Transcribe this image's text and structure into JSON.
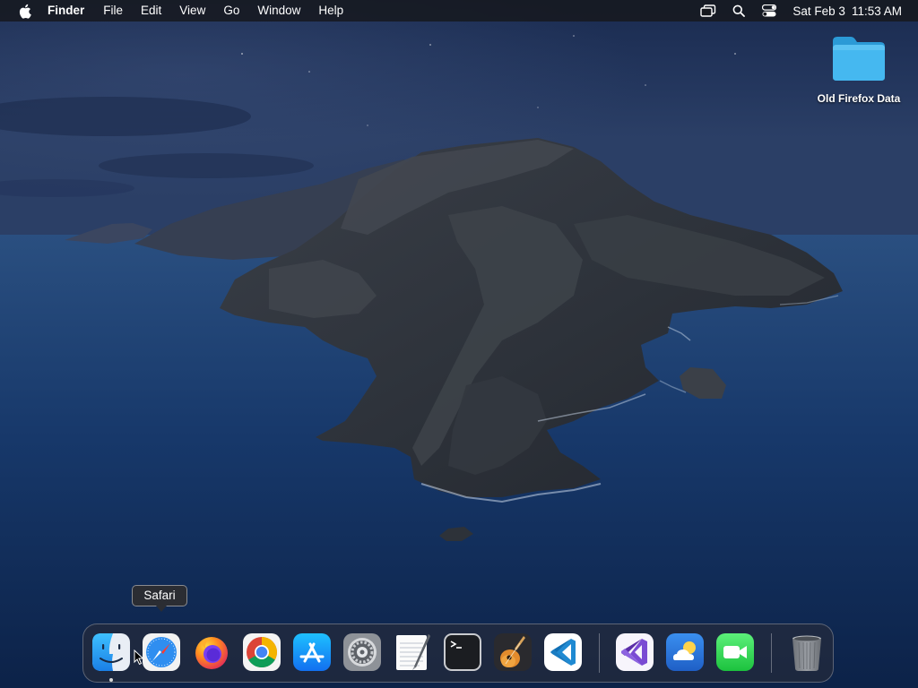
{
  "menubar": {
    "apple_icon": "apple-logo-icon",
    "app_name": "Finder",
    "menus": [
      "File",
      "Edit",
      "View",
      "Go",
      "Window",
      "Help"
    ],
    "status_icons": [
      "screen-mirroring-icon",
      "spotlight-search-icon",
      "control-center-icon"
    ],
    "clock": {
      "date": "Sat Feb 3",
      "time": "11:53 AM"
    }
  },
  "desktop": {
    "items": [
      {
        "label": "Old Firefox Data",
        "icon": "folder-icon",
        "color": "#3aaeea"
      }
    ]
  },
  "tooltip": {
    "text": "Safari"
  },
  "dock": {
    "apps": [
      {
        "name": "Finder",
        "icon": "finder-icon",
        "running": true
      },
      {
        "name": "Safari",
        "icon": "safari-icon",
        "running": false
      },
      {
        "name": "Firefox",
        "icon": "firefox-icon",
        "running": false
      },
      {
        "name": "Google Chrome",
        "icon": "chrome-icon",
        "running": false
      },
      {
        "name": "App Store",
        "icon": "app-store-icon",
        "running": false
      },
      {
        "name": "System Preferences",
        "icon": "system-preferences-icon",
        "running": false
      },
      {
        "name": "TextEdit",
        "icon": "textedit-icon",
        "running": false
      },
      {
        "name": "Terminal",
        "icon": "terminal-icon",
        "running": false
      },
      {
        "name": "GarageBand",
        "icon": "garageband-icon",
        "running": false
      },
      {
        "name": "Visual Studio Code",
        "icon": "vscode-icon",
        "running": false
      }
    ],
    "extra_apps": [
      {
        "name": "Visual Studio",
        "icon": "visual-studio-icon",
        "running": false
      },
      {
        "name": "Weather",
        "icon": "weather-icon",
        "running": false
      },
      {
        "name": "FaceTime",
        "icon": "facetime-icon",
        "running": false
      }
    ],
    "trash": {
      "name": "Trash",
      "icon": "trash-icon"
    }
  },
  "colors": {
    "menubar_bg": "#16181e",
    "wallpaper_sky": "#1b2c52",
    "wallpaper_sea": "#143463",
    "folder": "#3aaeea"
  }
}
